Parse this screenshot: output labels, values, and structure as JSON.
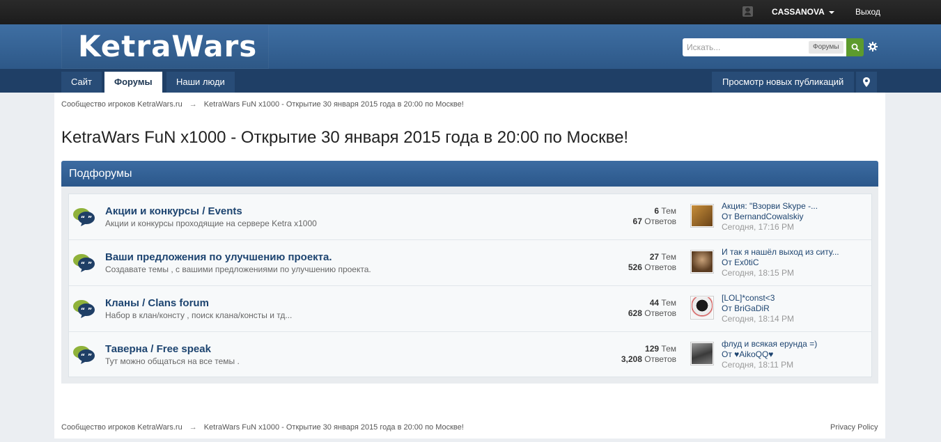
{
  "userbar": {
    "username": "CASSANOVA",
    "logout_label": "Выход"
  },
  "header": {
    "logo_text": "KetraWars",
    "search_placeholder": "Искать...",
    "search_scope": "Форумы"
  },
  "nav": {
    "items": [
      {
        "label": "Сайт"
      },
      {
        "label": "Форумы"
      },
      {
        "label": "Наши люди"
      }
    ],
    "new_posts_label": "Просмотр новых публикаций"
  },
  "breadcrumb": {
    "root": "Сообщество игроков KetraWars.ru",
    "arrow": "→",
    "current": "KetraWars FuN x1000 - Открытие 30 января 2015 года в 20:00 по Москве!"
  },
  "page_title": "KetraWars FuN x1000 - Открытие 30 января 2015 года в 20:00 по Москве!",
  "subforums": {
    "header": "Подфорумы",
    "forums": [
      {
        "title": "Акции и конкурсы / Events",
        "desc": "Акции и конкурсы проходящие на сервере Ketra x1000",
        "topics": "6",
        "topics_label": "Тем",
        "replies": "67",
        "replies_label": "Ответов",
        "last_title": "Акция: \"Взорви Skype -...",
        "last_by": "От BernandCowalskiy",
        "last_time": "Сегодня, 17:16 PM",
        "avatar_color": "#b07a2f"
      },
      {
        "title": "Ваши предложения по улучшению проекта.",
        "desc": "Создавате темы , с вашими предложениями по улучшению проекта.",
        "topics": "27",
        "topics_label": "Тем",
        "replies": "526",
        "replies_label": "Ответов",
        "last_title": "И так я нашёл выход из ситу...",
        "last_by": "От Ex0tiC",
        "last_time": "Сегодня, 18:15 PM",
        "avatar_color": "#7a5a3a"
      },
      {
        "title": "Кланы / Clans forum",
        "desc": "Набор в клан/консту , поиск клана/консты и тд...",
        "topics": "44",
        "topics_label": "Тем",
        "replies": "628",
        "replies_label": "Ответов",
        "last_title": "[LOL]*const<3",
        "last_by": "От BriGaDiR",
        "last_time": "Сегодня, 18:14 PM",
        "avatar_color": "#2b2b2b"
      },
      {
        "title": "Таверна / Free speak",
        "desc": "Тут можно общаться на все темы .",
        "topics": "129",
        "topics_label": "Тем",
        "replies": "3,208",
        "replies_label": "Ответов",
        "last_title": "флуд и всякая ерунда =)",
        "last_by": "От ♥AikoQQ♥",
        "last_time": "Сегодня, 18:11 PM",
        "avatar_color": "#5e5e5e"
      }
    ]
  },
  "footer": {
    "privacy_label": "Privacy Policy"
  }
}
